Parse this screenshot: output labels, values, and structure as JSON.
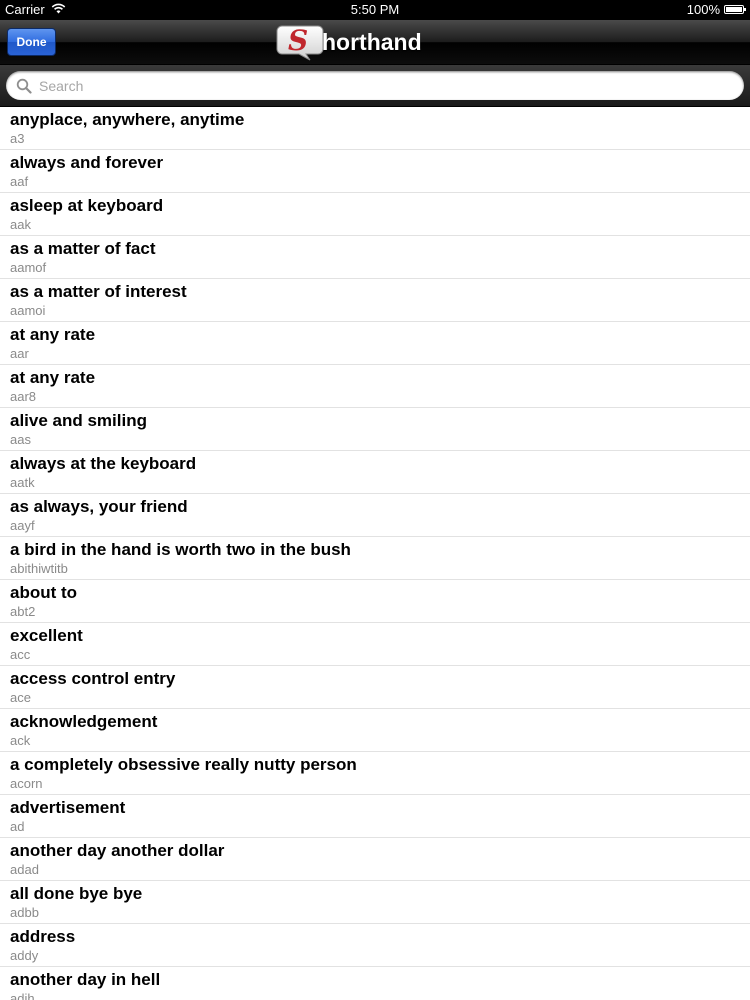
{
  "status_bar": {
    "carrier": "Carrier",
    "time": "5:50 PM",
    "battery": "100%"
  },
  "nav": {
    "done_label": "Done",
    "logo_letter": "S",
    "title_rest": "horthand"
  },
  "search": {
    "placeholder": "Search",
    "value": ""
  },
  "entries": [
    {
      "phrase": "anyplace, anywhere, anytime",
      "abbr": "a3"
    },
    {
      "phrase": "always and forever",
      "abbr": "aaf"
    },
    {
      "phrase": "asleep at keyboard",
      "abbr": "aak"
    },
    {
      "phrase": "as a matter of fact",
      "abbr": "aamof"
    },
    {
      "phrase": "as a matter of interest",
      "abbr": "aamoi"
    },
    {
      "phrase": "at any rate",
      "abbr": "aar"
    },
    {
      "phrase": "at any rate",
      "abbr": "aar8"
    },
    {
      "phrase": "alive and smiling",
      "abbr": "aas"
    },
    {
      "phrase": "always at the keyboard",
      "abbr": "aatk"
    },
    {
      "phrase": "as always, your friend",
      "abbr": "aayf"
    },
    {
      "phrase": "a bird in the hand is worth two in the bush",
      "abbr": "abithiwtitb"
    },
    {
      "phrase": "about to",
      "abbr": "abt2"
    },
    {
      "phrase": "excellent",
      "abbr": "acc"
    },
    {
      "phrase": "access control entry",
      "abbr": "ace"
    },
    {
      "phrase": "acknowledgement",
      "abbr": "ack"
    },
    {
      "phrase": "a completely obsessive really nutty person",
      "abbr": "acorn"
    },
    {
      "phrase": "advertisement",
      "abbr": "ad"
    },
    {
      "phrase": "another day another dollar",
      "abbr": "adad"
    },
    {
      "phrase": "all done bye bye",
      "abbr": "adbb"
    },
    {
      "phrase": "address",
      "abbr": "addy"
    },
    {
      "phrase": "another day in hell",
      "abbr": "adih"
    }
  ],
  "icons": {
    "wifi": "wifi-icon",
    "battery": "battery-icon",
    "search": "search-icon",
    "logo": "speech-bubble-logo-icon"
  },
  "colors": {
    "done_button": "#2f6ce0",
    "logo_red": "#c0272d",
    "navbar": "#1c1c1c"
  }
}
